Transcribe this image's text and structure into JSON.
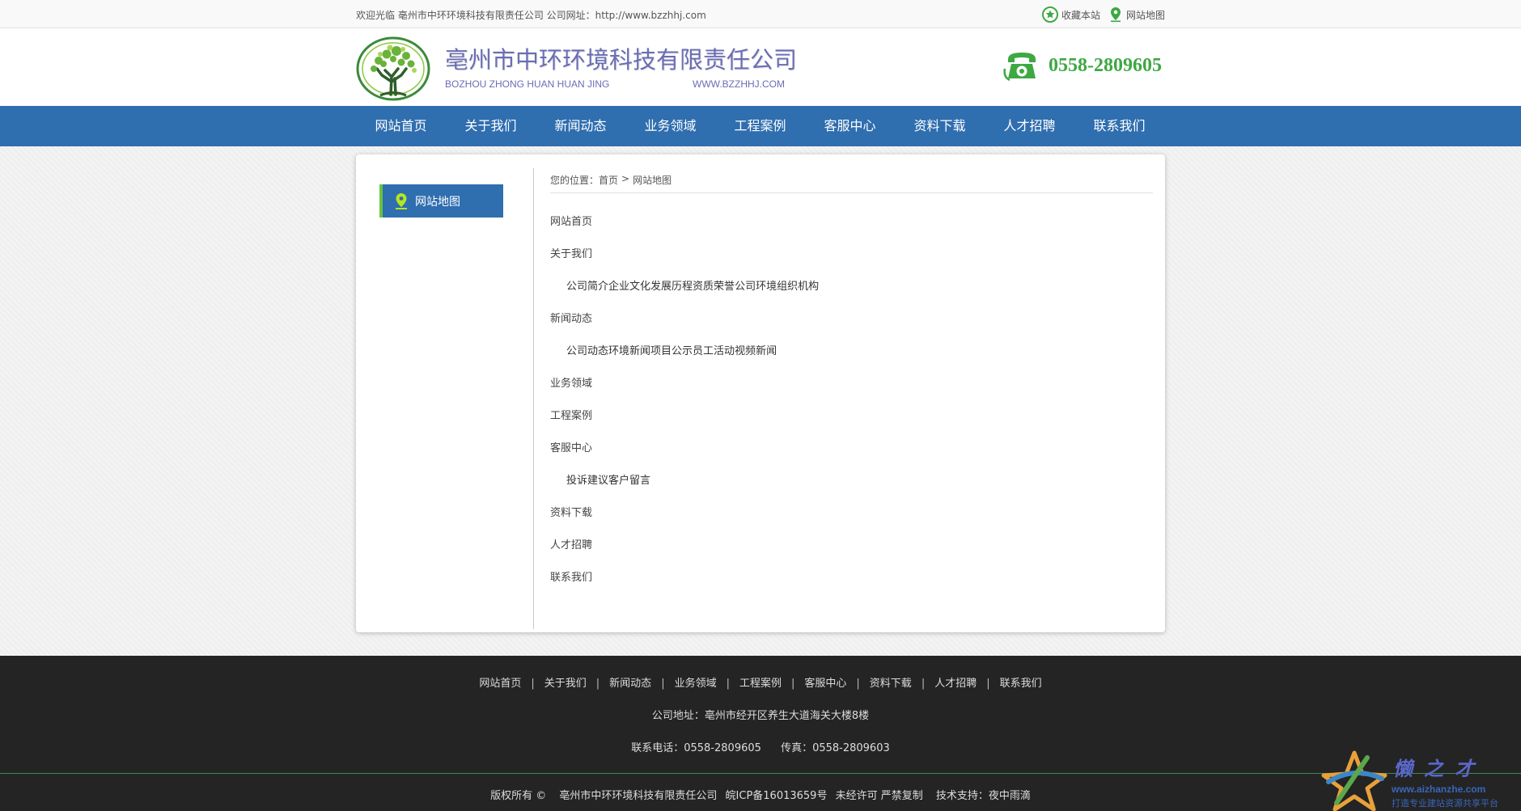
{
  "topbar": {
    "welcome": "欢迎光临 亳州市中环环境科技有限责任公司 公司网址：http://www.bzzhhj.com",
    "favorite": "收藏本站",
    "sitemap": "网站地图"
  },
  "header": {
    "company": "亳州市中环环境科技有限责任公司",
    "pinyin": "BOZHOU ZHONG HUAN HUAN JING",
    "domain": "WWW.BZZHHJ.COM",
    "phone": "0558-2809605"
  },
  "nav": {
    "items": [
      "网站首页",
      "关于我们",
      "新闻动态",
      "业务领域",
      "工程案例",
      "客服中心",
      "资料下载",
      "人才招聘",
      "联系我们"
    ]
  },
  "sidebar": {
    "title": "网站地图"
  },
  "breadcrumb": {
    "prefix": "您的位置：",
    "home": "首页",
    "sep": ">",
    "current": "网站地图"
  },
  "sitemap": {
    "home": "网站首页",
    "about": {
      "label": "关于我们",
      "subs": [
        "公司简介",
        "企业文化",
        "发展历程",
        "资质荣誉",
        "公司环境",
        "组织机构"
      ]
    },
    "news": {
      "label": "新闻动态",
      "subs": [
        "公司动态",
        "环境新闻",
        "项目公示",
        "员工活动",
        "视频新闻"
      ]
    },
    "business": "业务领域",
    "cases": "工程案例",
    "service": {
      "label": "客服中心",
      "subs": [
        "投诉建议",
        "客户留言"
      ]
    },
    "download": "资料下载",
    "jobs": "人才招聘",
    "contact": "联系我们"
  },
  "footer": {
    "links": [
      "网站首页",
      "关于我们",
      "新闻动态",
      "业务领域",
      "工程案例",
      "客服中心",
      "资料下载",
      "人才招聘",
      "联系我们"
    ],
    "sep": "|",
    "address": "公司地址：亳州市经开区养生大道海关大楼8楼",
    "tel": "联系电话：0558-2809605",
    "fax": "传真：0558-2809603",
    "copyright": "版权所有 ©",
    "company": "亳州市中环环境科技有限责任公司",
    "icp": "皖ICP备16013659号",
    "notice": "未经许可 严禁复制",
    "support": "技术支持：夜中雨滴"
  },
  "watermark": {
    "title": "懒之才",
    "url": "www.aizhanzhe.com",
    "slogan": "打造专业建站资源共享平台"
  },
  "colors": {
    "nav": "#2f6eaf",
    "accent_green": "#3ea843",
    "footer": "#242424",
    "logo_text": "#6a6db5"
  }
}
